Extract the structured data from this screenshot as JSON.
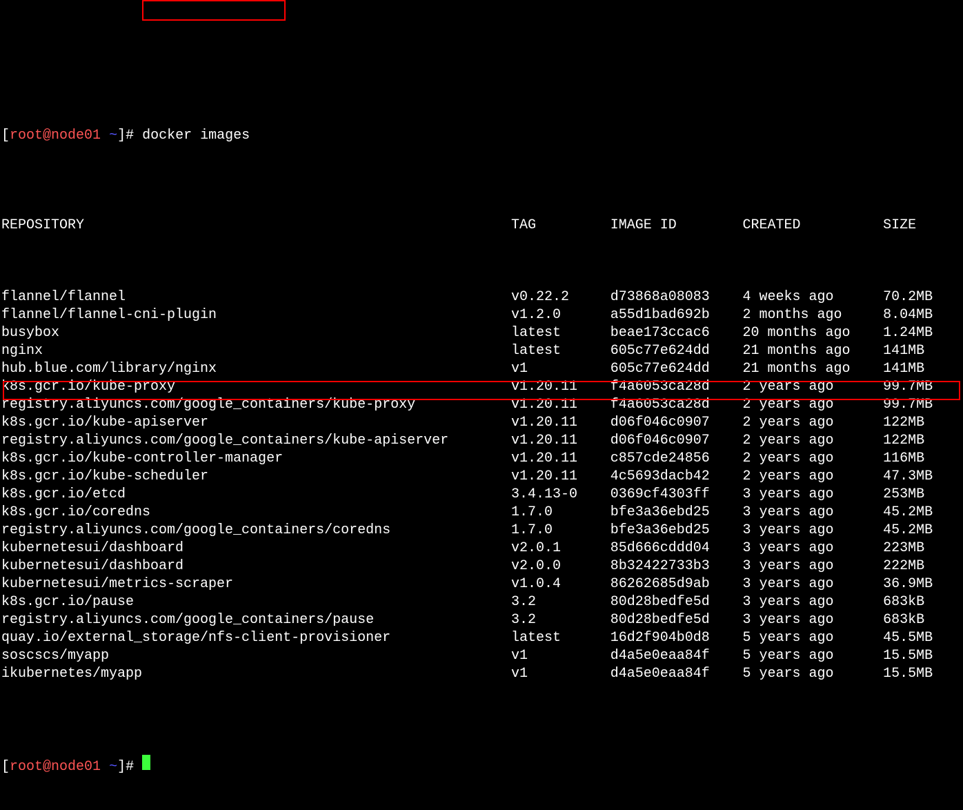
{
  "prompt": {
    "user": "root",
    "at": "@",
    "host": "node01",
    "path": "~",
    "hash": "#",
    "open": "[",
    "close": "]"
  },
  "command": "docker images",
  "header": {
    "repo": "REPOSITORY",
    "tag": "TAG",
    "imageid": "IMAGE ID",
    "created": "CREATED",
    "size": "SIZE"
  },
  "rows": [
    {
      "repo": "flannel/flannel",
      "tag": "v0.22.2",
      "imageid": "d73868a08083",
      "created": "4 weeks ago",
      "size": "70.2MB"
    },
    {
      "repo": "flannel/flannel-cni-plugin",
      "tag": "v1.2.0",
      "imageid": "a55d1bad692b",
      "created": "2 months ago",
      "size": "8.04MB"
    },
    {
      "repo": "busybox",
      "tag": "latest",
      "imageid": "beae173ccac6",
      "created": "20 months ago",
      "size": "1.24MB"
    },
    {
      "repo": "nginx",
      "tag": "latest",
      "imageid": "605c77e624dd",
      "created": "21 months ago",
      "size": "141MB"
    },
    {
      "repo": "hub.blue.com/library/nginx",
      "tag": "v1",
      "imageid": "605c77e624dd",
      "created": "21 months ago",
      "size": "141MB"
    },
    {
      "repo": "k8s.gcr.io/kube-proxy",
      "tag": "v1.20.11",
      "imageid": "f4a6053ca28d",
      "created": "2 years ago",
      "size": "99.7MB"
    },
    {
      "repo": "registry.aliyuncs.com/google_containers/kube-proxy",
      "tag": "v1.20.11",
      "imageid": "f4a6053ca28d",
      "created": "2 years ago",
      "size": "99.7MB"
    },
    {
      "repo": "k8s.gcr.io/kube-apiserver",
      "tag": "v1.20.11",
      "imageid": "d06f046c0907",
      "created": "2 years ago",
      "size": "122MB"
    },
    {
      "repo": "registry.aliyuncs.com/google_containers/kube-apiserver",
      "tag": "v1.20.11",
      "imageid": "d06f046c0907",
      "created": "2 years ago",
      "size": "122MB"
    },
    {
      "repo": "k8s.gcr.io/kube-controller-manager",
      "tag": "v1.20.11",
      "imageid": "c857cde24856",
      "created": "2 years ago",
      "size": "116MB"
    },
    {
      "repo": "k8s.gcr.io/kube-scheduler",
      "tag": "v1.20.11",
      "imageid": "4c5693dacb42",
      "created": "2 years ago",
      "size": "47.3MB"
    },
    {
      "repo": "k8s.gcr.io/etcd",
      "tag": "3.4.13-0",
      "imageid": "0369cf4303ff",
      "created": "3 years ago",
      "size": "253MB"
    },
    {
      "repo": "k8s.gcr.io/coredns",
      "tag": "1.7.0",
      "imageid": "bfe3a36ebd25",
      "created": "3 years ago",
      "size": "45.2MB"
    },
    {
      "repo": "registry.aliyuncs.com/google_containers/coredns",
      "tag": "1.7.0",
      "imageid": "bfe3a36ebd25",
      "created": "3 years ago",
      "size": "45.2MB"
    },
    {
      "repo": "kubernetesui/dashboard",
      "tag": "v2.0.1",
      "imageid": "85d666cddd04",
      "created": "3 years ago",
      "size": "223MB"
    },
    {
      "repo": "kubernetesui/dashboard",
      "tag": "v2.0.0",
      "imageid": "8b32422733b3",
      "created": "3 years ago",
      "size": "222MB"
    },
    {
      "repo": "kubernetesui/metrics-scraper",
      "tag": "v1.0.4",
      "imageid": "86262685d9ab",
      "created": "3 years ago",
      "size": "36.9MB"
    },
    {
      "repo": "k8s.gcr.io/pause",
      "tag": "3.2",
      "imageid": "80d28bedfe5d",
      "created": "3 years ago",
      "size": "683kB"
    },
    {
      "repo": "registry.aliyuncs.com/google_containers/pause",
      "tag": "3.2",
      "imageid": "80d28bedfe5d",
      "created": "3 years ago",
      "size": "683kB"
    },
    {
      "repo": "quay.io/external_storage/nfs-client-provisioner",
      "tag": "latest",
      "imageid": "16d2f904b0d8",
      "created": "5 years ago",
      "size": "45.5MB"
    },
    {
      "repo": "soscscs/myapp",
      "tag": "v1",
      "imageid": "d4a5e0eaa84f",
      "created": "5 years ago",
      "size": "15.5MB"
    },
    {
      "repo": "ikubernetes/myapp",
      "tag": "v1",
      "imageid": "d4a5e0eaa84f",
      "created": "5 years ago",
      "size": "15.5MB"
    }
  ]
}
